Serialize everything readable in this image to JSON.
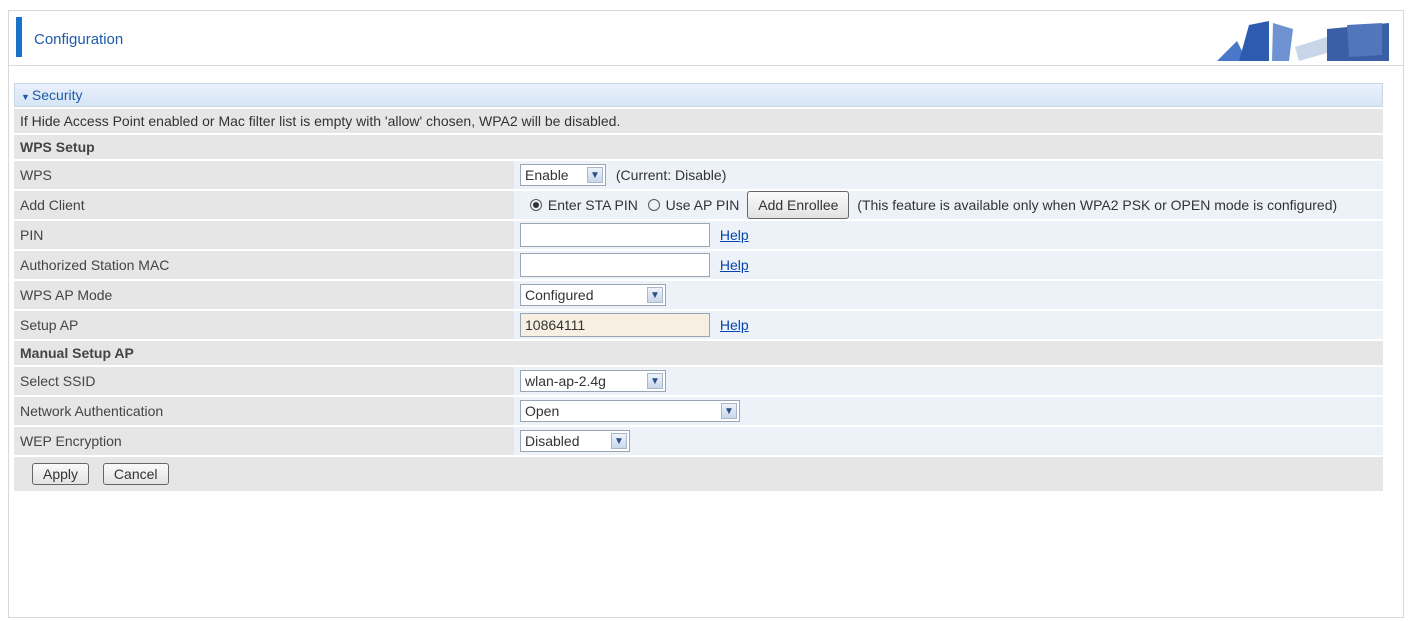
{
  "header": {
    "title": "Configuration"
  },
  "section": {
    "title": "Security"
  },
  "note": "If Hide Access Point enabled or Mac filter list is empty with 'allow' chosen, WPA2 will be disabled.",
  "wps_setup": {
    "heading": "WPS Setup",
    "wps": {
      "label": "WPS",
      "value": "Enable",
      "current": "(Current: Disable)"
    },
    "add_client": {
      "label": "Add Client",
      "opt1": "Enter STA PIN",
      "opt2": "Use AP PIN",
      "button": "Add Enrollee",
      "note": "(This feature is available only when WPA2 PSK or OPEN mode is configured)"
    },
    "pin": {
      "label": "PIN",
      "value": "",
      "help": "Help"
    },
    "auth_mac": {
      "label": "Authorized Station MAC",
      "value": "",
      "help": "Help"
    },
    "ap_mode": {
      "label": "WPS AP Mode",
      "value": "Configured"
    },
    "setup_ap": {
      "label": "Setup AP",
      "value": "10864111",
      "help": "Help"
    }
  },
  "manual": {
    "heading": "Manual Setup AP",
    "ssid": {
      "label": "Select SSID",
      "value": "wlan-ap-2.4g"
    },
    "auth": {
      "label": "Network Authentication",
      "value": "Open"
    },
    "wep": {
      "label": "WEP Encryption",
      "value": "Disabled"
    }
  },
  "buttons": {
    "apply": "Apply",
    "cancel": "Cancel"
  },
  "colors": {
    "accent": "#1a73c8",
    "link": "#0645ad",
    "label_bg": "#e6e6e6",
    "field_bg": "#edf2f9"
  }
}
